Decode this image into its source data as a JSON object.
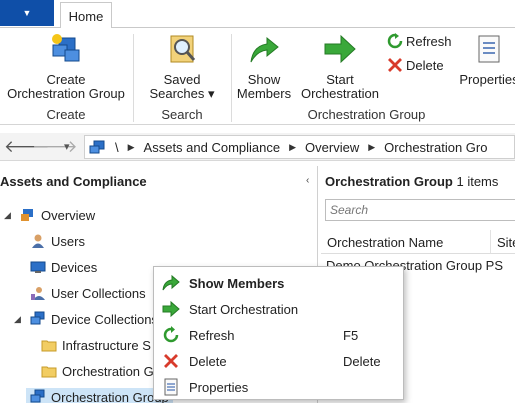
{
  "ribbon_tabs": {
    "home_label": "Home",
    "app_menu_glyph": "▼"
  },
  "ribbon": {
    "create_group": {
      "button_label_line1": "Create",
      "button_label_line2": "Orchestration Group",
      "group_label": "Create"
    },
    "search_group": {
      "button_label_line1": "Saved",
      "button_label_line2": "Searches ▾",
      "group_label": "Search"
    },
    "orch_group": {
      "show_line1": "Show",
      "show_line2": "Members",
      "start_line1": "Start",
      "start_line2": "Orchestration",
      "refresh_label": "Refresh",
      "delete_label": "Delete",
      "properties_label": "Properties",
      "group_label": "Orchestration Group"
    }
  },
  "address": {
    "back_glyph": "🡐",
    "forward_glyph": "🡒",
    "dropdown_glyph": "▾",
    "root": "\\",
    "crumbs": [
      "Assets and Compliance",
      "Overview",
      "Orchestration Gro"
    ]
  },
  "left_pane": {
    "title": "Assets and Compliance",
    "collapse_glyph": "‹",
    "tree": {
      "overview": "Overview",
      "users": "Users",
      "devices": "Devices",
      "user_collections": "User Collections",
      "device_collections": "Device Collections",
      "infrastructure": "Infrastructure S",
      "orchestration_folder": "Orchestration G",
      "orchestration_group": "Orchestration Group"
    }
  },
  "right_pane": {
    "title_bold": "Orchestration Group",
    "title_count": "1 items",
    "search_placeholder": "Search",
    "columns": [
      "Orchestration Name",
      "Site"
    ],
    "row": "Demo Orchestration Group  PS"
  },
  "context_menu": {
    "items": [
      {
        "label": "Show Members",
        "shortcut": "",
        "icon": "green-curved-arrow-icon"
      },
      {
        "label": "Start Orchestration",
        "shortcut": "",
        "icon": "green-arrow-icon"
      },
      {
        "label": "Refresh",
        "shortcut": "F5",
        "icon": "refresh-icon"
      },
      {
        "label": "Delete",
        "shortcut": "Delete",
        "icon": "red-x-icon"
      },
      {
        "label": "Properties",
        "shortcut": "",
        "icon": "properties-sheet-icon"
      }
    ]
  },
  "colors": {
    "accent": "#0f4fa8",
    "green": "#3aa83a",
    "red": "#d83b2c",
    "selection": "#cde4f7"
  }
}
